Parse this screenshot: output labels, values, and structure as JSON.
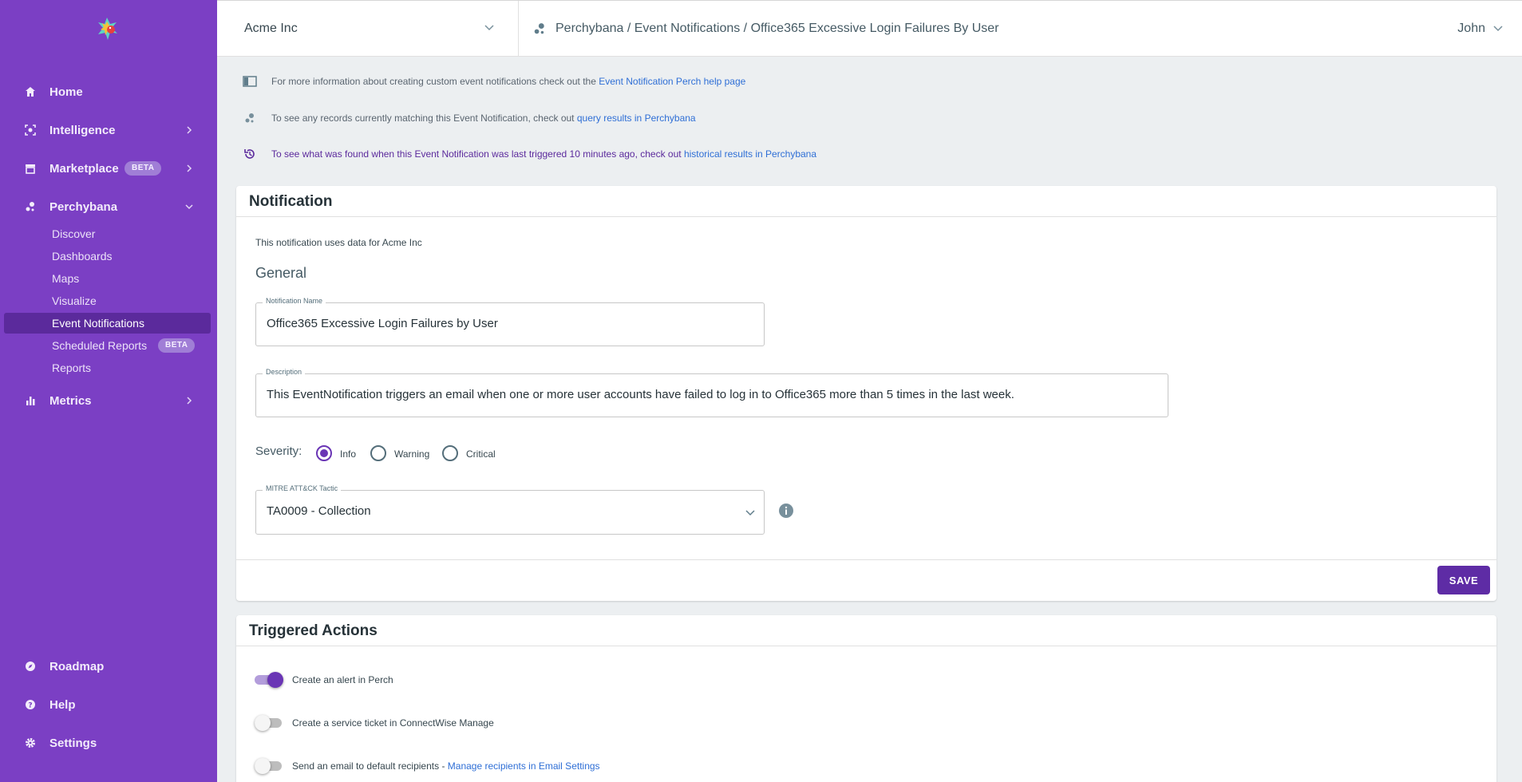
{
  "sidebar": {
    "logo_icon": "parrot-logo-icon",
    "items": [
      {
        "label": "Home",
        "icon": "home-icon"
      },
      {
        "label": "Intelligence",
        "icon": "intelligence-icon"
      },
      {
        "label": "Marketplace",
        "icon": "store-icon",
        "badge": "BETA"
      },
      {
        "label": "Perchybana",
        "icon": "perchybana-icon"
      },
      {
        "label": "Metrics",
        "icon": "bar-chart-icon"
      }
    ],
    "perchybana_sub": [
      {
        "label": "Discover"
      },
      {
        "label": "Dashboards"
      },
      {
        "label": "Maps"
      },
      {
        "label": "Visualize"
      },
      {
        "label": "Event Notifications",
        "active": true
      },
      {
        "label": "Scheduled Reports",
        "badge": "BETA"
      },
      {
        "label": "Reports"
      }
    ],
    "bottom_items": [
      {
        "label": "Roadmap",
        "icon": "compass-icon"
      },
      {
        "label": "Help",
        "icon": "help-icon"
      },
      {
        "label": "Settings",
        "icon": "gear-icon"
      }
    ]
  },
  "header": {
    "org": "Acme Inc",
    "breadcrumb": "Perchybana / Event Notifications / Office365 Excessive Login Failures By User",
    "user": "John"
  },
  "info": {
    "line1_text": "For more information about creating custom event notifications check out the ",
    "line1_link": "Event Notification Perch help page",
    "line2_text": "To see any records currently matching this Event Notification, check out ",
    "line2_link": "query results in Perchybana",
    "line3_text": "To see what was found when this Event Notification was last triggered 10 minutes ago, check out ",
    "line3_link": "historical results in Perchybana"
  },
  "notification": {
    "title": "Notification",
    "data_note": "This notification uses data for Acme Inc",
    "section": "General",
    "name_label": "Notification Name",
    "name_value": "Office365 Excessive Login Failures by User",
    "desc_label": "Description",
    "desc_value": "This EventNotification triggers an email when one or more user accounts have failed to log in to Office365 more than 5 times in the last week.",
    "severity_label": "Severity:",
    "severity_options": [
      "Info",
      "Warning",
      "Critical"
    ],
    "severity_selected": "Info",
    "mitre_label": "MITRE ATT&CK Tactic",
    "mitre_value": "TA0009 - Collection",
    "save_label": "SAVE"
  },
  "triggered": {
    "title": "Triggered Actions",
    "actions": [
      {
        "label": "Create an alert in Perch",
        "enabled": true
      },
      {
        "label": "Create a service ticket in ConnectWise Manage",
        "enabled": false
      },
      {
        "label": "Send an email to default recipients - ",
        "link": "Manage recipients in Email Settings",
        "enabled": false
      }
    ]
  },
  "colors": {
    "sidebar": "#7b3fc4",
    "active": "#5b2a9c",
    "accent": "#6a35b5",
    "link": "#2f6fd6"
  }
}
